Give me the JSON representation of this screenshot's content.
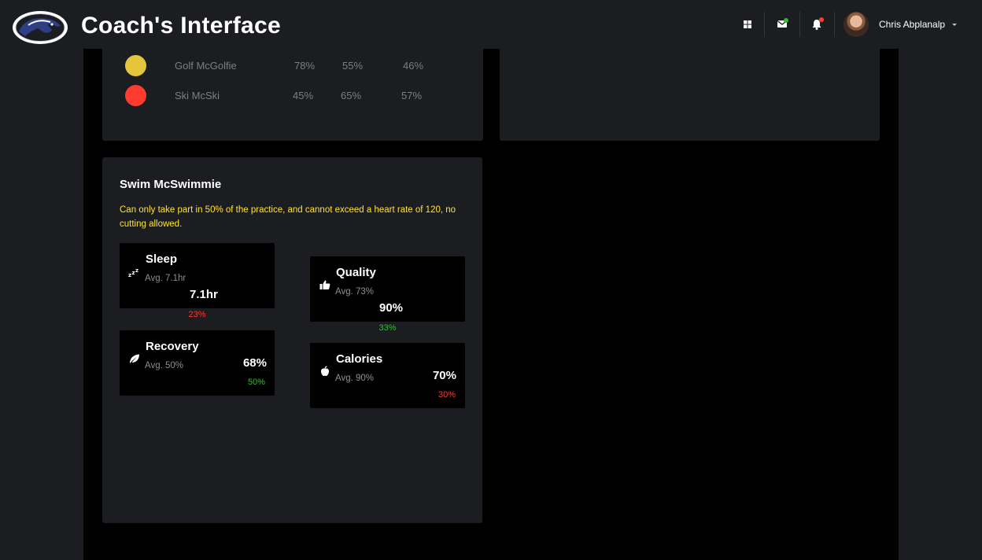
{
  "header": {
    "title": "Coach's Interface",
    "logo_icon": "mustang-logo-icon",
    "icons": [
      "apps-grid-icon",
      "mail-icon",
      "bell-icon"
    ],
    "user_name": "Chris Abplanalp"
  },
  "table_rows": [
    {
      "name": "Golf McGolfie",
      "status_color": "#e3c63c",
      "values": [
        "78%",
        "55%",
        "46%"
      ]
    },
    {
      "name": "Ski McSki",
      "status_color": "#ff3b30",
      "values": [
        "45%",
        "65%",
        "57%"
      ]
    }
  ],
  "athlete": {
    "name": "Swim McSwimmie",
    "note": "Can only take part in 50% of the practice, and cannot exceed a heart rate of 120, no cutting allowed.",
    "metrics": {
      "sleep": {
        "title": "Sleep",
        "avg": "Avg. 7.1hr",
        "value": "7.1hr",
        "delta": "23%",
        "delta_color": "red",
        "icon": "sleep-zzz-icon"
      },
      "quality": {
        "title": "Quality",
        "avg": "Avg. 73%",
        "value": "90%",
        "delta": "33%",
        "delta_color": "green",
        "icon": "thumbs-up-icon"
      },
      "recovery": {
        "title": "Recovery",
        "avg": "Avg. 50%",
        "value": "68%",
        "delta": "50%",
        "delta_color": "green",
        "icon": "leaf-icon"
      },
      "calories": {
        "title": "Calories",
        "avg": "Avg. 90%",
        "value": "70%",
        "delta": "30%",
        "delta_color": "red",
        "icon": "apple-icon"
      }
    }
  },
  "colors": {
    "accent_red": "#ff3b30",
    "accent_green": "#35b93a",
    "note_yellow": "#ffe233",
    "notification_dot": "#ff3b30",
    "mail_dot": "#35b93a"
  }
}
